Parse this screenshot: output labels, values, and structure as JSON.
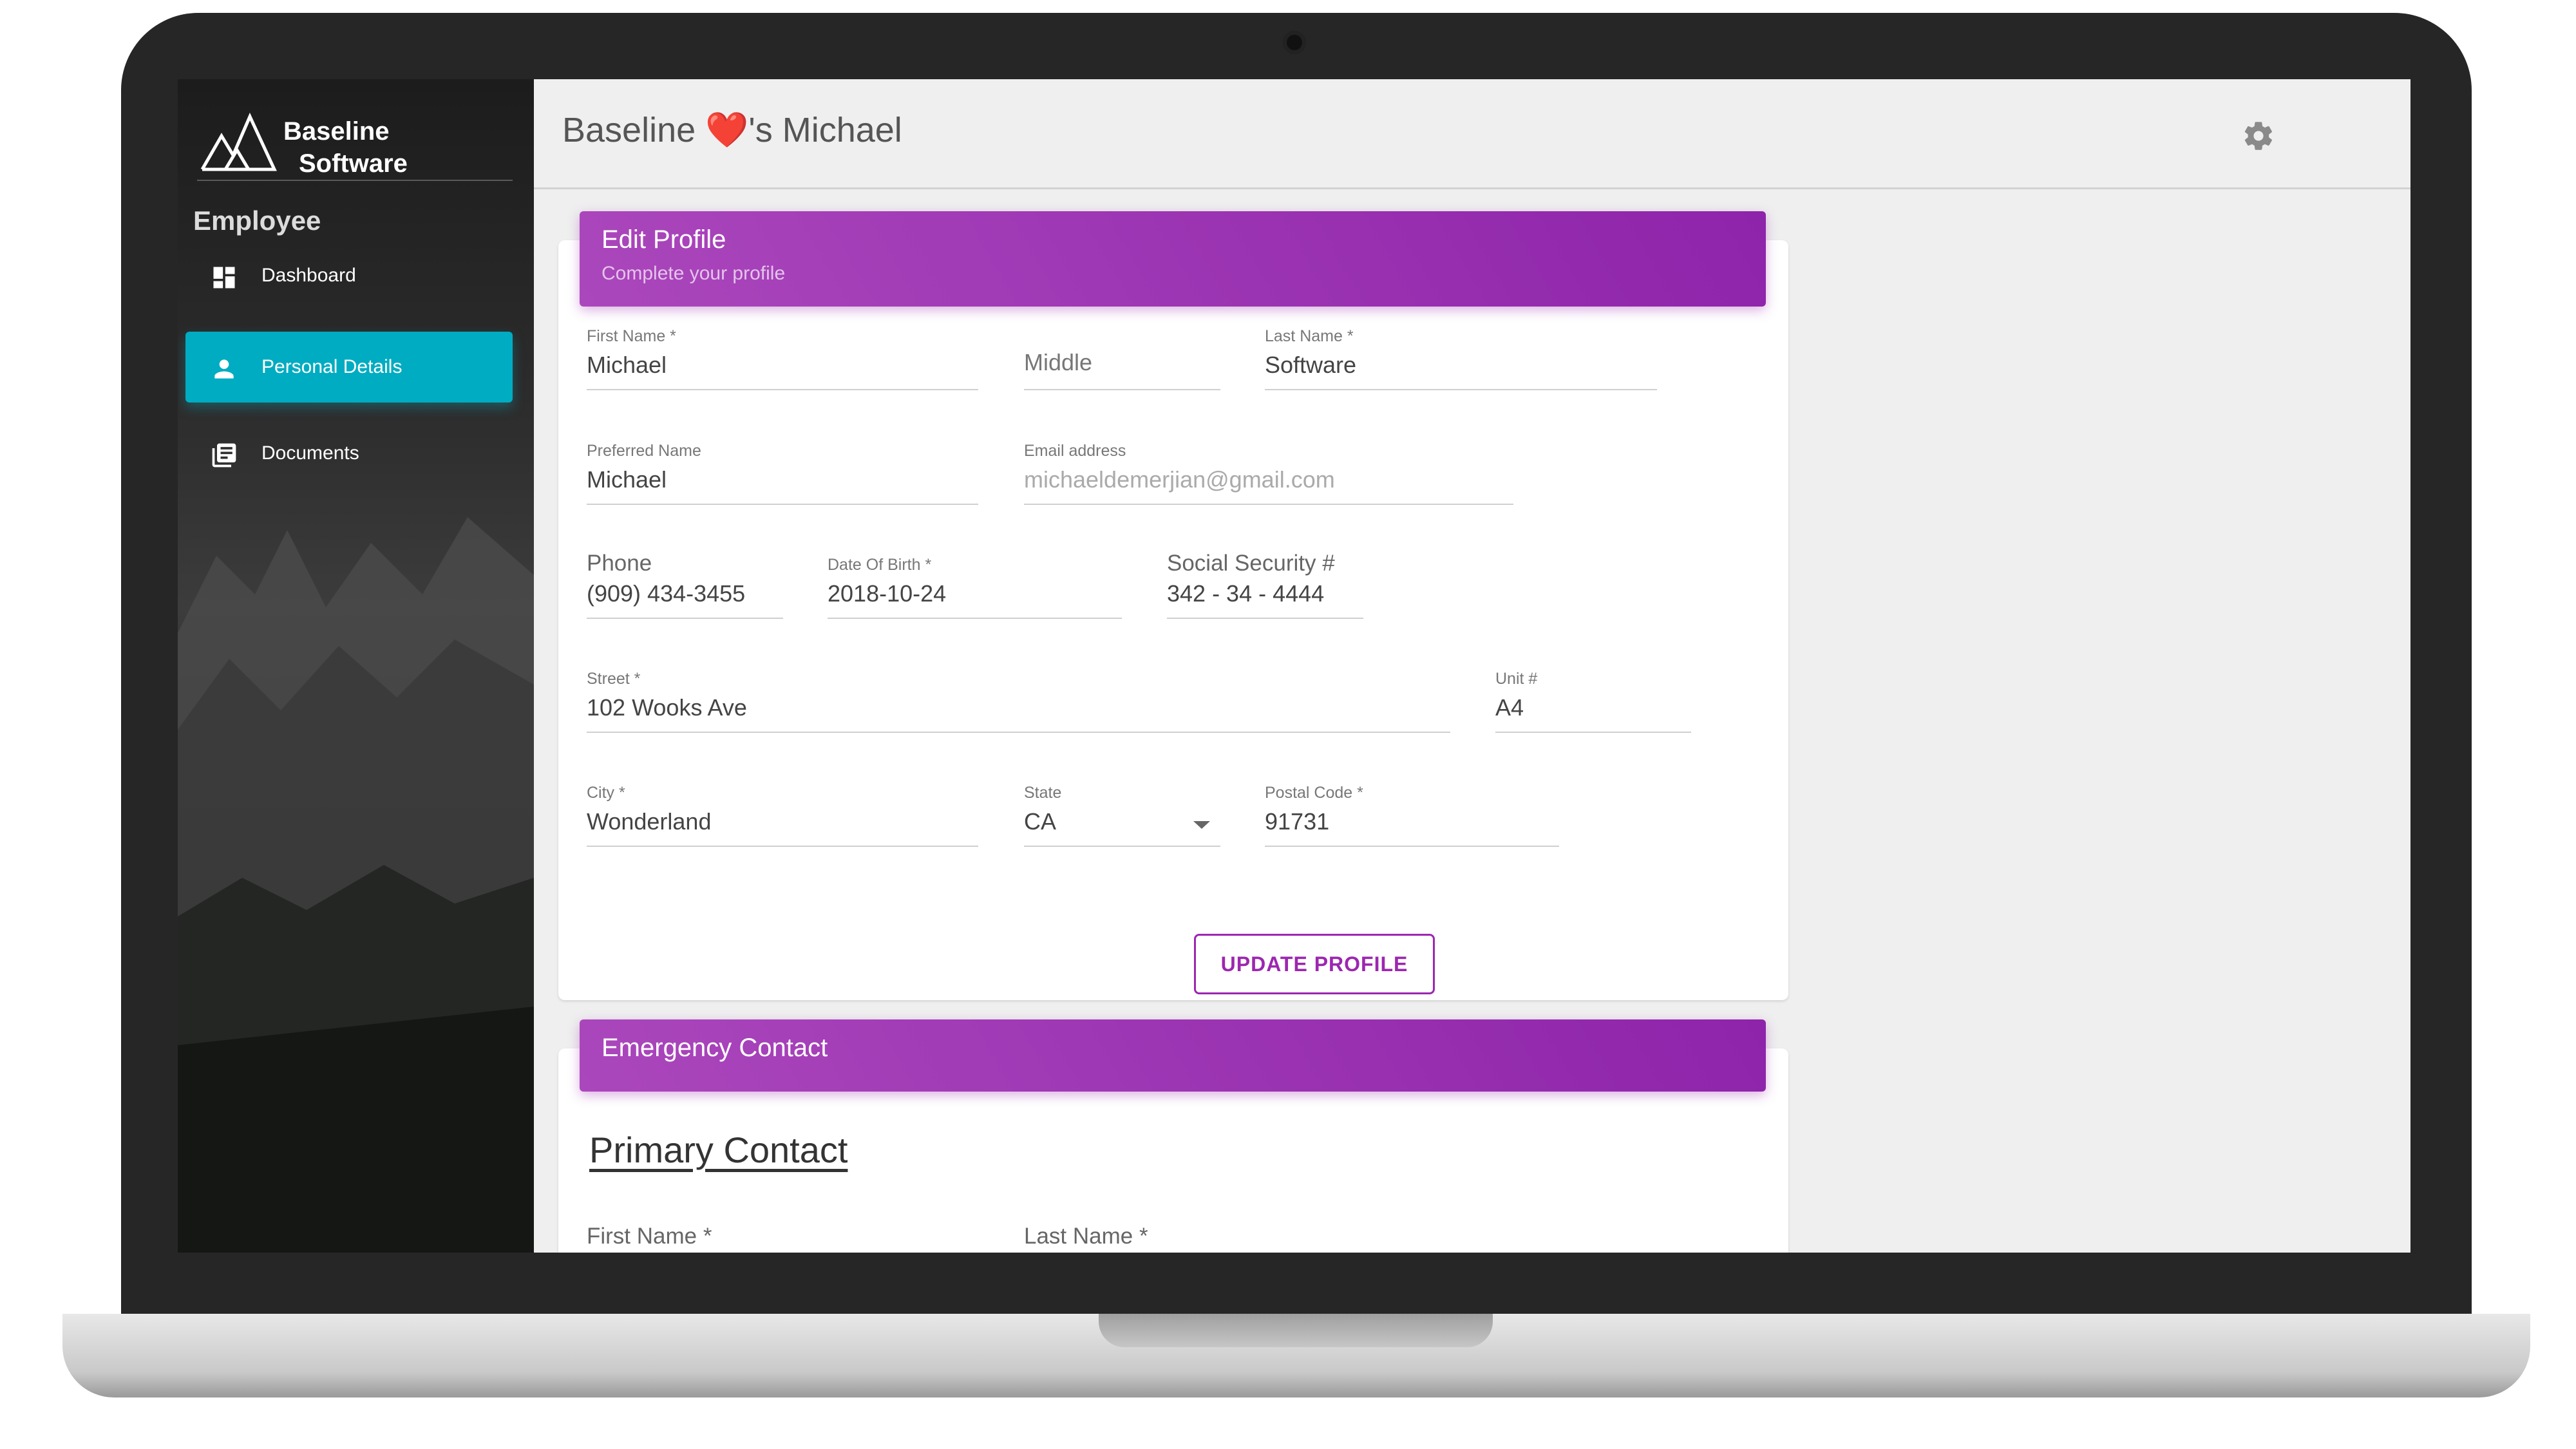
{
  "app": {
    "logo_line1": "Baseline",
    "logo_line2": "Software",
    "section": "Employee",
    "brand_title_prefix": "Baseline ",
    "brand_title_heart": "❤️",
    "brand_title_suffix": "'s Michael"
  },
  "sidebar": {
    "items": [
      {
        "label": "Dashboard",
        "icon": "dashboard-icon",
        "active": false
      },
      {
        "label": "Personal Details",
        "icon": "person-icon",
        "active": true
      },
      {
        "label": "Documents",
        "icon": "library-books-icon",
        "active": false
      }
    ]
  },
  "edit_profile": {
    "title": "Edit Profile",
    "subtitle": "Complete your profile",
    "fields": {
      "first_name": {
        "label": "First Name *",
        "value": "Michael"
      },
      "middle": {
        "placeholder": "Middle"
      },
      "last_name": {
        "label": "Last Name *",
        "value": "Software"
      },
      "preferred_name": {
        "label": "Preferred Name",
        "value": "Michael"
      },
      "email": {
        "label": "Email address",
        "value": "michaeldemerjian@gmail.com"
      },
      "phone": {
        "label": "Phone",
        "value": "(909) 434-3455"
      },
      "dob": {
        "label": "Date Of Birth *",
        "value": "2018-10-24"
      },
      "ssn": {
        "label": "Social Security #",
        "value": "342 - 34 - 4444"
      },
      "street": {
        "label": "Street *",
        "value": "102 Wooks Ave"
      },
      "unit": {
        "label": "Unit #",
        "value": "A4"
      },
      "city": {
        "label": "City *",
        "value": "Wonderland"
      },
      "state": {
        "label": "State",
        "value": "CA"
      },
      "postal": {
        "label": "Postal Code *",
        "value": "91731"
      }
    },
    "update_button": "UPDATE PROFILE"
  },
  "emergency_contact": {
    "title": "Emergency Contact",
    "primary_contact": "Primary Contact",
    "first_name_label": "First Name *",
    "last_name_label": "Last Name *"
  },
  "colors": {
    "accent_purple": "#9c27b0",
    "active_cyan": "#00acc1",
    "heart_red": "#e0201e"
  }
}
